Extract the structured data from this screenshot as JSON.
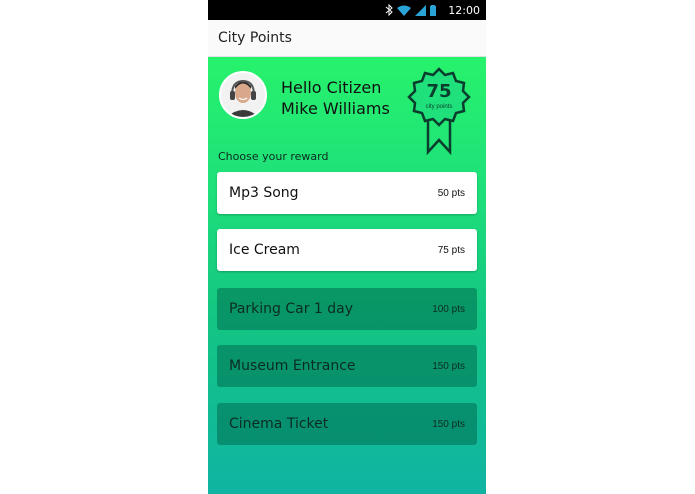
{
  "statusbar": {
    "time": "12:00",
    "icons": [
      "bluetooth-icon",
      "wifi-icon",
      "signal-icon",
      "battery-icon"
    ]
  },
  "appbar": {
    "title": "City Points"
  },
  "profile": {
    "greeting_line1": "Hello Citizen",
    "greeting_line2": "Mike Williams",
    "avatar": "user-avatar-with-headphones"
  },
  "badge": {
    "points": "75",
    "label": "city points"
  },
  "rewards_heading": "Choose your reward",
  "rewards": [
    {
      "name": "Mp3 Song",
      "points": "50 pts",
      "available": true
    },
    {
      "name": "Ice Cream",
      "points": "75 pts",
      "available": true
    },
    {
      "name": "Parking Car 1 day",
      "points": "100 pts",
      "available": false
    },
    {
      "name": "Museum Entrance",
      "points": "150 pts",
      "available": false
    },
    {
      "name": "Cinema Ticket",
      "points": "150 pts",
      "available": false
    }
  ],
  "colors": {
    "gradient_top": "#27f26b",
    "gradient_bottom": "#10b4a2",
    "badge_ink": "#0b3d2e",
    "locked_card": "#0a8a5e"
  }
}
